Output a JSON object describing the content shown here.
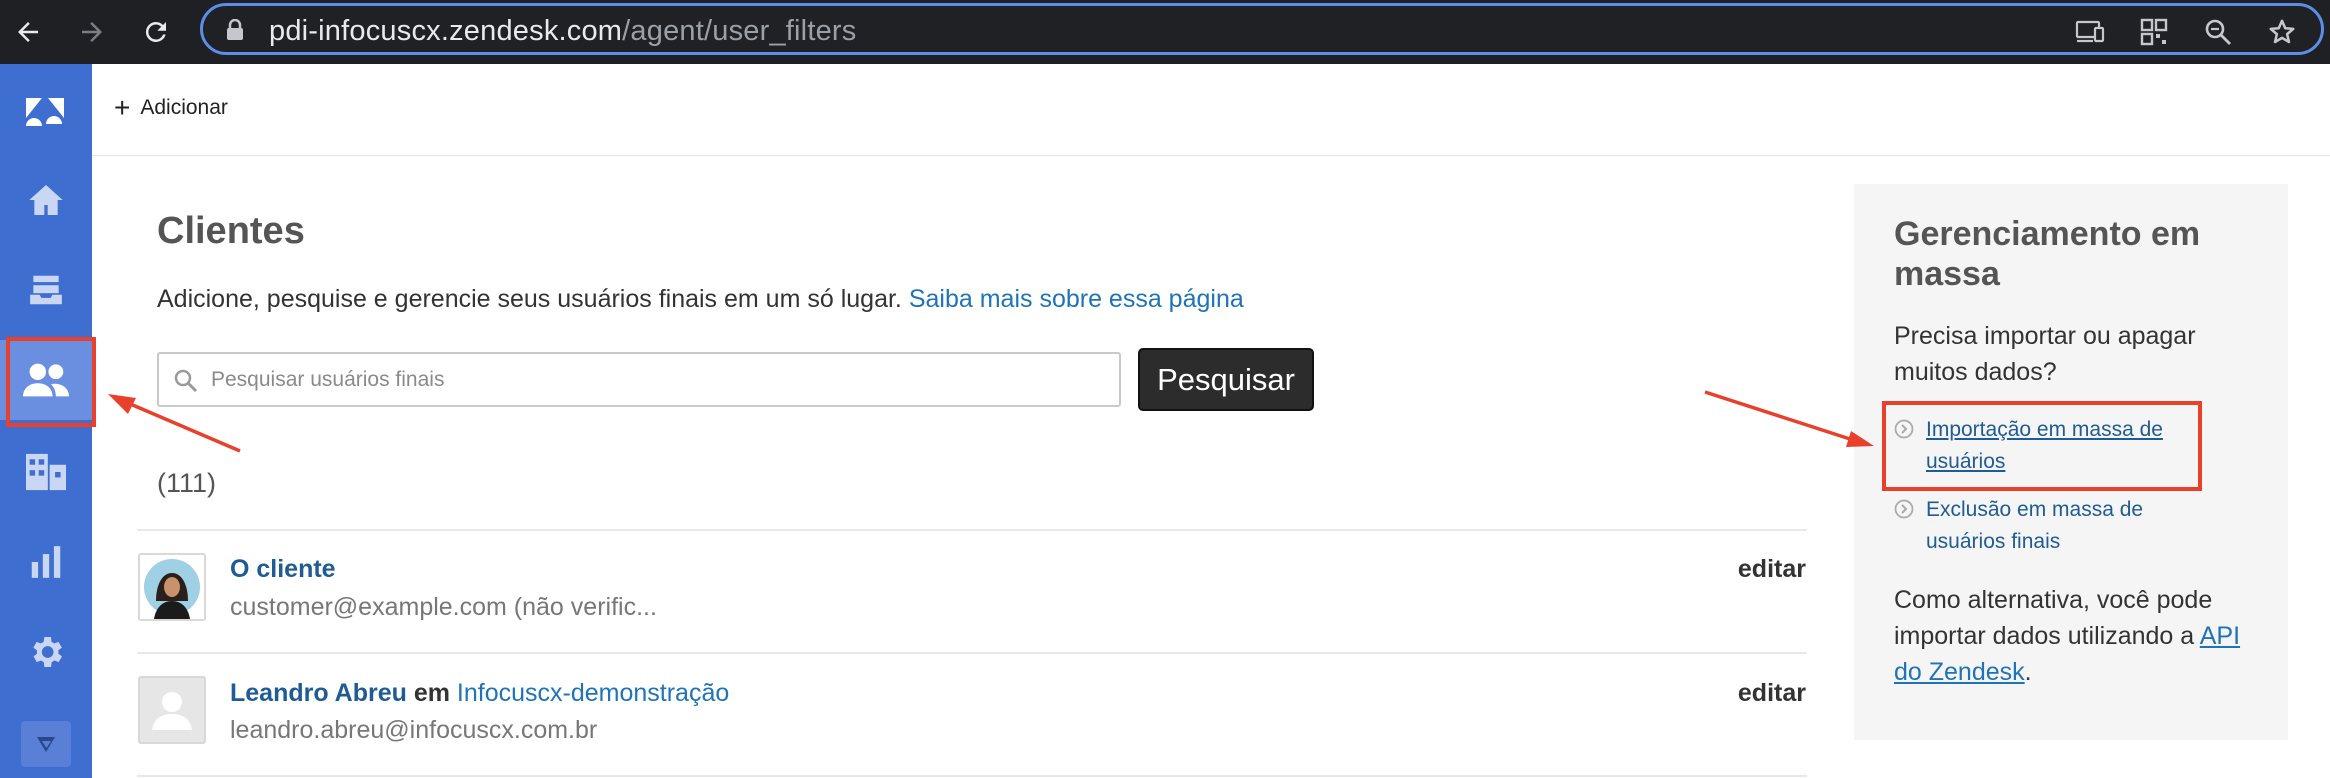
{
  "browser": {
    "url_host": "pdi-infocuscx.zendesk.com",
    "url_path": "/agent/user_filters",
    "icons": [
      "back-arrow-icon",
      "forward-arrow-icon",
      "reload-icon",
      "lock-icon",
      "cast-icon",
      "qr-code-icon",
      "zoom-icon",
      "star-icon"
    ]
  },
  "sidebar": {
    "items": [
      "zendesk-logo",
      "home",
      "views",
      "customers",
      "organizations",
      "reporting",
      "admin",
      "apps"
    ],
    "active": "customers",
    "accent": "#3e6ecf"
  },
  "topbar": {
    "add_label": "Adicionar"
  },
  "main": {
    "title": "Clientes",
    "description": "Adicione, pesquise e gerencie seus usuários finais em um só lugar.",
    "learn_more": "Saiba mais sobre essa página",
    "search_placeholder": "Pesquisar usuários finais",
    "search_button": "Pesquisar",
    "count": "(111)",
    "users": [
      {
        "name": "O cliente",
        "email": "customer@example.com (não verific...",
        "edit": "editar"
      },
      {
        "name": "Leandro Abreu",
        "em": "em",
        "org": "Infocuscx-demonstração",
        "email": "leandro.abreu@infocuscx.com.br",
        "edit": "editar"
      }
    ]
  },
  "panel": {
    "title": "Gerenciamento em massa",
    "question": "Precisa importar ou apagar muitos dados?",
    "link_import": "Importação em massa de usuários",
    "link_delete": "Exclusão em massa de usuários finais",
    "alt_text": "Como alternativa, você pode importar dados utilizando a",
    "api_link": "API do Zendesk",
    "period": "."
  },
  "annotation_color": "#e8402a"
}
